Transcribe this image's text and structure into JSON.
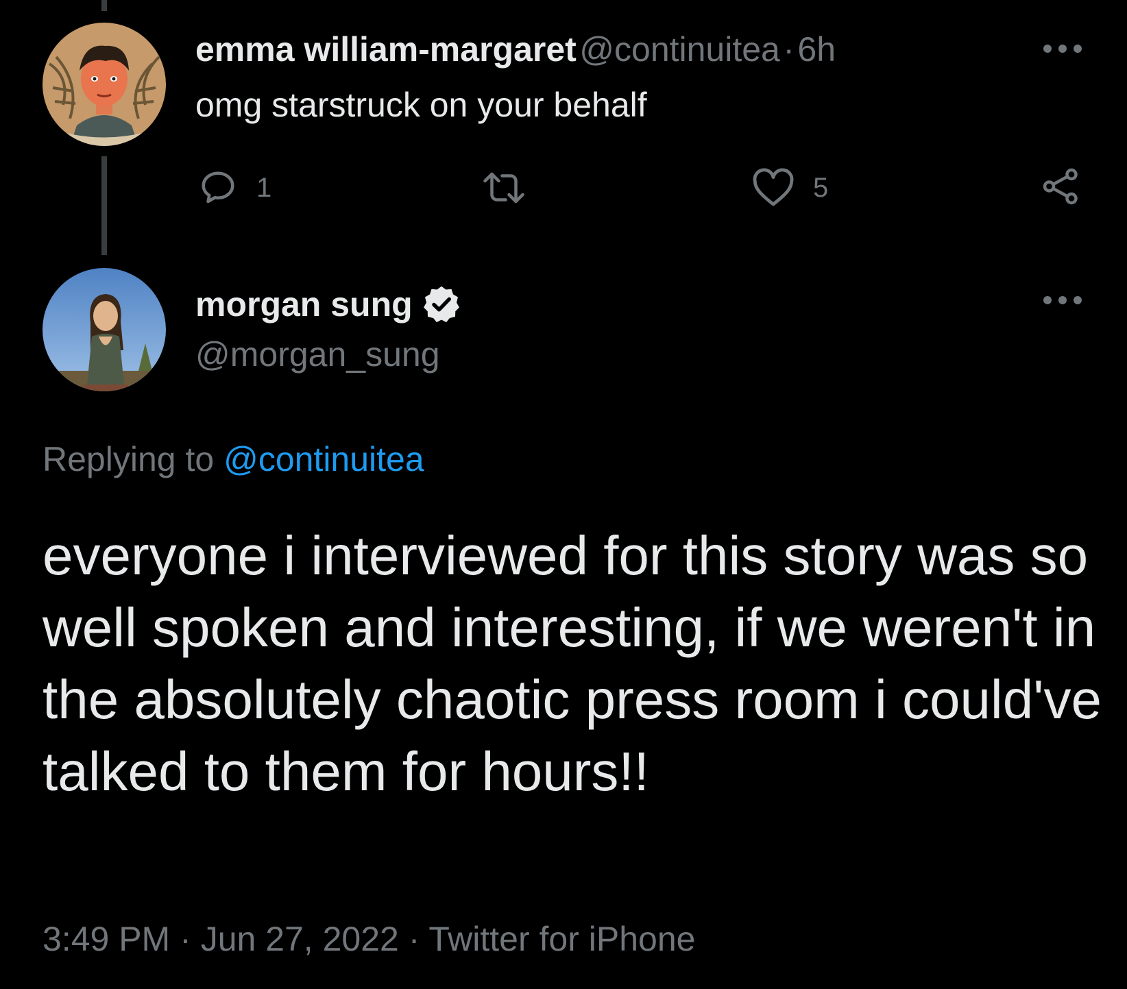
{
  "parent_tweet": {
    "display_name": "emma william-margaret",
    "handle": "@continuitea",
    "separator": "·",
    "time_ago": "6h",
    "text": "omg starstruck on your behalf",
    "reply_count": "1",
    "retweet_count": "",
    "like_count": "5",
    "icons": [
      "reply-icon",
      "retweet-icon",
      "like-icon",
      "share-icon",
      "more-icon"
    ]
  },
  "main_tweet": {
    "display_name": "morgan sung",
    "handle": "@morgan_sung",
    "verified": true,
    "replying_prefix": "Replying to",
    "replying_to": "@continuitea",
    "text": "everyone i interviewed for this story was so well spoken and interesting, if we weren't in the absolutely chaotic press room i could've talked to them for hours!!",
    "time": "3:49 PM",
    "sep1": "·",
    "date": "Jun 27, 2022",
    "sep2": "·",
    "source": "Twitter for iPhone"
  },
  "colors": {
    "background": "#000000",
    "text_primary": "#e7e9ea",
    "text_secondary": "#71767b",
    "link": "#1d9bf0",
    "thread_line": "#3a3d40"
  }
}
